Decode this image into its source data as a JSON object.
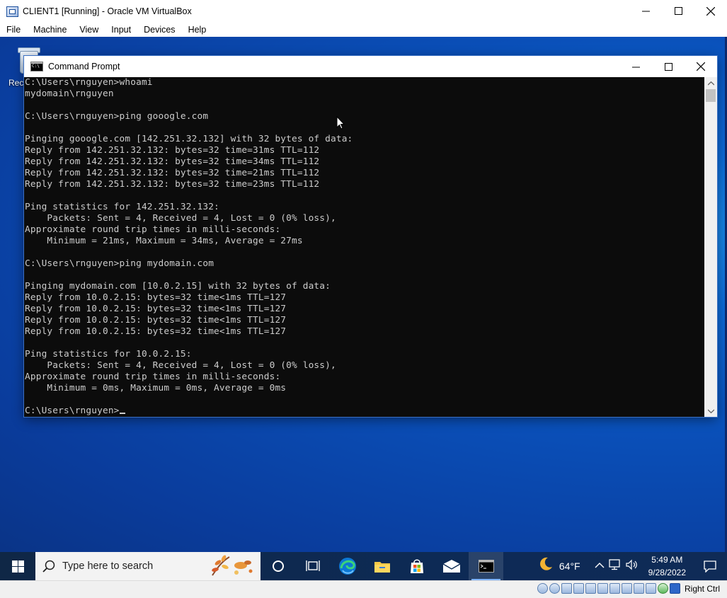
{
  "vbox": {
    "title": "CLIENT1 [Running] - Oracle VM VirtualBox",
    "menu": [
      "File",
      "Machine",
      "View",
      "Input",
      "Devices",
      "Help"
    ],
    "window_buttons": {
      "minimize": "─",
      "maximize": "☐",
      "close": "✕"
    },
    "status": {
      "host_key": "Right Ctrl"
    }
  },
  "desktop": {
    "recycle_bin_label": "Recy"
  },
  "cmd": {
    "title": "Command Prompt",
    "lines": [
      "C:\\Users\\rnguyen>whoami",
      "mydomain\\rnguyen",
      "",
      "C:\\Users\\rnguyen>ping gooogle.com",
      "",
      "Pinging gooogle.com [142.251.32.132] with 32 bytes of data:",
      "Reply from 142.251.32.132: bytes=32 time=31ms TTL=112",
      "Reply from 142.251.32.132: bytes=32 time=34ms TTL=112",
      "Reply from 142.251.32.132: bytes=32 time=21ms TTL=112",
      "Reply from 142.251.32.132: bytes=32 time=23ms TTL=112",
      "",
      "Ping statistics for 142.251.32.132:",
      "    Packets: Sent = 4, Received = 4, Lost = 0 (0% loss),",
      "Approximate round trip times in milli-seconds:",
      "    Minimum = 21ms, Maximum = 34ms, Average = 27ms",
      "",
      "C:\\Users\\rnguyen>ping mydomain.com",
      "",
      "Pinging mydomain.com [10.0.2.15] with 32 bytes of data:",
      "Reply from 10.0.2.15: bytes=32 time<1ms TTL=127",
      "Reply from 10.0.2.15: bytes=32 time<1ms TTL=127",
      "Reply from 10.0.2.15: bytes=32 time<1ms TTL=127",
      "Reply from 10.0.2.15: bytes=32 time<1ms TTL=127",
      "",
      "Ping statistics for 10.0.2.15:",
      "    Packets: Sent = 4, Received = 4, Lost = 0 (0% loss),",
      "Approximate round trip times in milli-seconds:",
      "    Minimum = 0ms, Maximum = 0ms, Average = 0ms",
      ""
    ],
    "prompt": "C:\\Users\\rnguyen>"
  },
  "taskbar": {
    "search_placeholder": "Type here to search",
    "pinned": [
      "task-view-icon",
      "edge-icon",
      "file-explorer-icon",
      "store-icon",
      "mail-icon",
      "command-prompt-icon"
    ],
    "weather_temp": "64°F",
    "clock_time": "5:49 AM",
    "clock_date": "9/28/2022",
    "tray_chevron": "^"
  },
  "colors": {
    "console_bg": "#0c0c0c",
    "console_fg": "#cccccc",
    "desktop_blue": "#0a4fb8",
    "taskbar_bg": "#0d2a55"
  }
}
